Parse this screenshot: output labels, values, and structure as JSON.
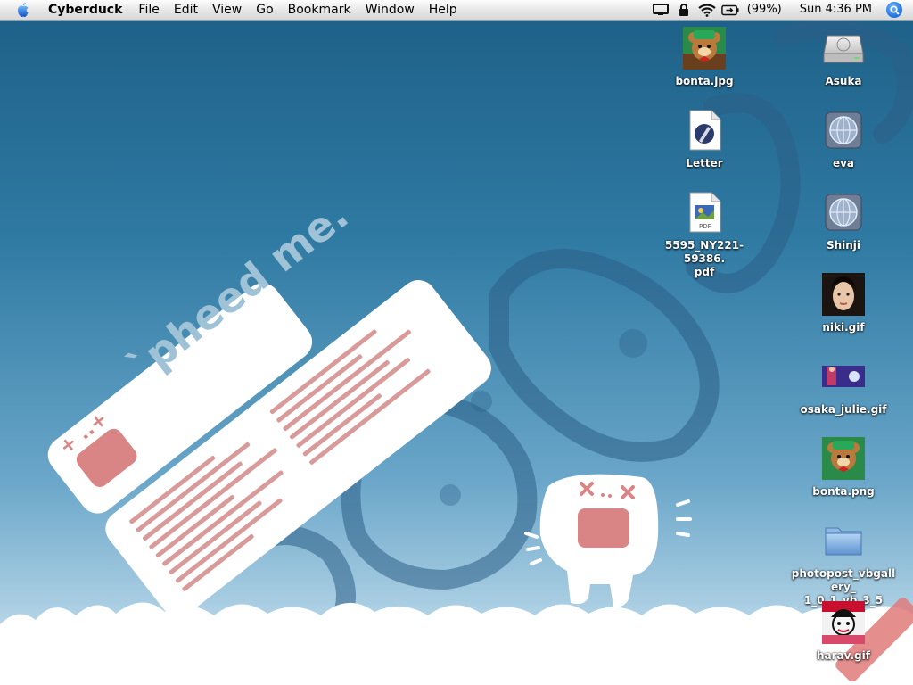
{
  "menubar": {
    "app_name": "Cyberduck",
    "items": [
      "File",
      "Edit",
      "View",
      "Go",
      "Bookmark",
      "Window",
      "Help"
    ],
    "battery": "(99%)",
    "clock": "Sun 4:36 PM"
  },
  "wallpaper": {
    "card_title": "`pheed me."
  },
  "desktop_icons": [
    {
      "label": "bonta.jpg",
      "icon": "bear-image-icon"
    },
    {
      "label": "Letter",
      "icon": "document-pen-icon"
    },
    {
      "label": "5595_NY221-59386.\npdf",
      "icon": "pdf-document-icon"
    },
    {
      "label": "Asuka",
      "icon": "hard-drive-icon"
    },
    {
      "label": "eva",
      "icon": "network-volume-icon"
    },
    {
      "label": "Shinji",
      "icon": "network-volume-icon"
    },
    {
      "label": "niki.gif",
      "icon": "portrait-image-icon"
    },
    {
      "label": "osaka_julie.gif",
      "icon": "banner-image-icon"
    },
    {
      "label": "bonta.png",
      "icon": "bear-image-icon"
    },
    {
      "label": "photopost_vbgallery_\n1_0_1_vb_3_5",
      "icon": "folder-icon"
    },
    {
      "label": "harav.gif",
      "icon": "avatar-image-icon"
    }
  ],
  "colors": {
    "accent_pink": "#d98585",
    "spotlight_blue": "#1d6fe0"
  }
}
